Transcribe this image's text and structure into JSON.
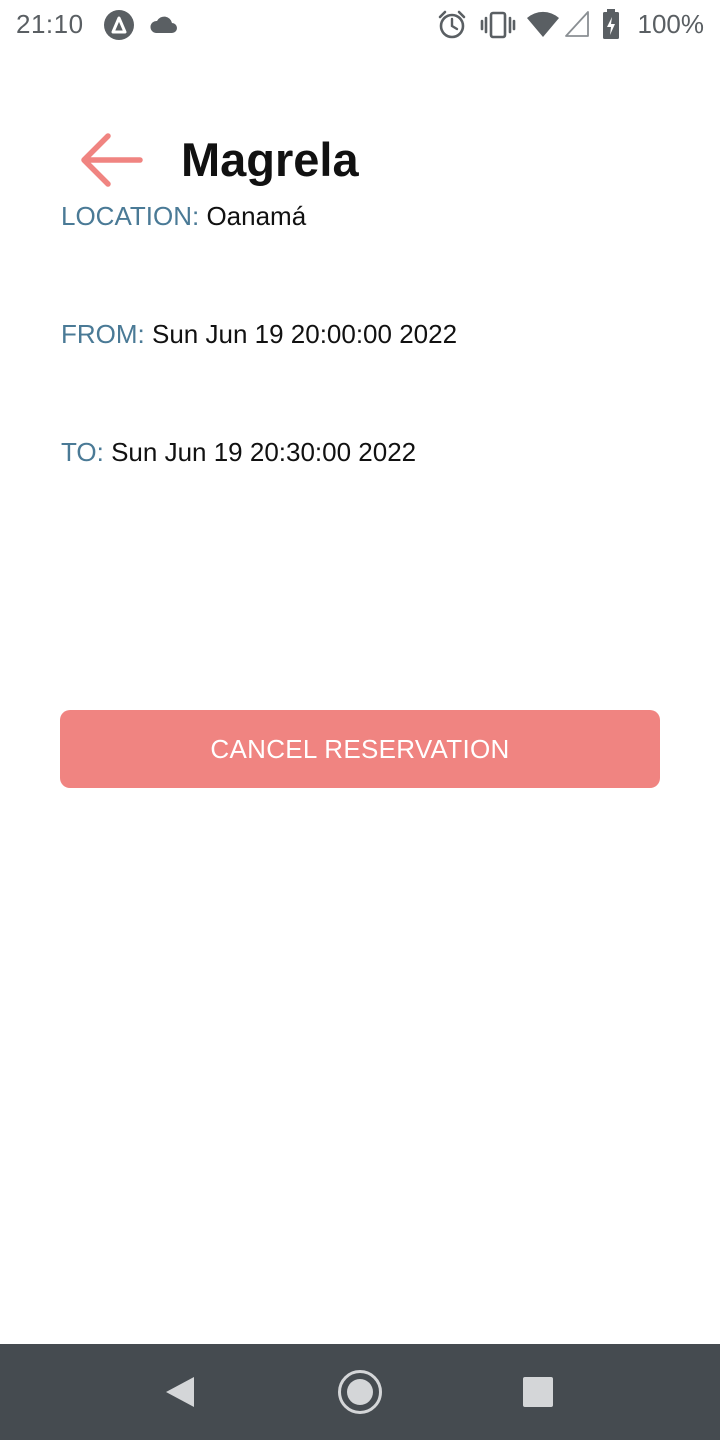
{
  "status_bar": {
    "time": "21:10",
    "battery_percent": "100%",
    "icons": [
      "app-notification-icon",
      "cloud-icon",
      "alarm-icon",
      "vibrate-icon",
      "wifi-icon",
      "cell-signal-icon",
      "battery-charging-icon"
    ]
  },
  "header": {
    "back_icon": "arrow-left-icon",
    "title": "Magrela"
  },
  "details": {
    "location_label": "LOCATION:",
    "location_value": "Oanamá",
    "from_label": "FROM:",
    "from_value": "Sun Jun 19 20:00:00 2022",
    "to_label": "TO:",
    "to_value": "Sun Jun 19 20:30:00 2022"
  },
  "actions": {
    "cancel_label": "CANCEL RESERVATION"
  },
  "colors": {
    "accent": "#f08481",
    "label": "#4a7a96",
    "nav_bar": "#454b50"
  },
  "nav_bar": {
    "icons": [
      "nav-back-icon",
      "nav-home-icon",
      "nav-recents-icon"
    ]
  }
}
